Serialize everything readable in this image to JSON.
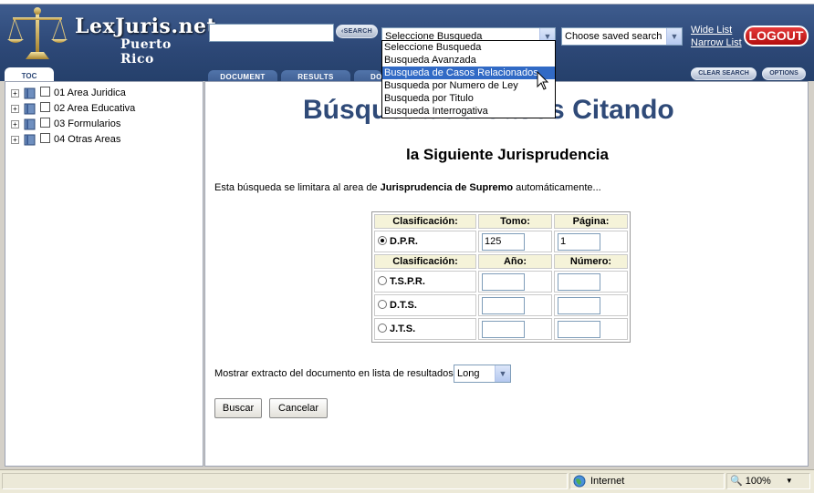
{
  "header": {
    "logo_title": "LexJuris.net",
    "logo_subtitle": "Puerto Rico",
    "search_value": "",
    "search_button": "SEARCH",
    "search_type_selected": "Seleccione Busqueda",
    "saved_search_selected": "Choose saved search",
    "wide_list": "Wide List",
    "narrow_list": "Narrow List",
    "logout": "LOGOUT"
  },
  "search_type_options": [
    "Seleccione Busqueda",
    "Busqueda Avanzada",
    "Busqueda de Casos Relacionados",
    "Busqueda por Numero de Ley",
    "Busqueda por Titulo",
    "Busqueda Interrogativa"
  ],
  "tabs": {
    "toc": "TOC",
    "document": "DOCUMENT",
    "results": "RESULTS",
    "doc_partial": "DO",
    "clear_search": "CLEAR SEARCH",
    "options": "OPTIONS"
  },
  "tree": [
    {
      "label": "01 Area Juridica"
    },
    {
      "label": "02 Area Educativa"
    },
    {
      "label": "03 Formularios"
    },
    {
      "label": "04 Otras Areas"
    }
  ],
  "main": {
    "title": "Búsqueda de Casos Citando",
    "subtitle": "la Siguiente Jurisprudencia",
    "notice_pre": "Esta búsqueda se limitara al area de ",
    "notice_bold": "Jurisprudencia de Supremo",
    "notice_post": " automáticamente...",
    "table1": {
      "headers": [
        "Clasificación:",
        "Tomo:",
        "Página:"
      ],
      "row": {
        "label": "D.P.R.",
        "tomo": "125",
        "pagina": "1",
        "selected": true
      }
    },
    "table2": {
      "headers": [
        "Clasificación:",
        "Año:",
        "Número:"
      ],
      "rows": [
        {
          "label": "T.S.P.R.",
          "ano": "",
          "numero": ""
        },
        {
          "label": "D.T.S.",
          "ano": "",
          "numero": ""
        },
        {
          "label": "J.T.S.",
          "ano": "",
          "numero": ""
        }
      ]
    },
    "extract_label": "Mostrar extracto del documento en lista de resultados",
    "extract_value": "Long",
    "buscar": "Buscar",
    "cancelar": "Cancelar"
  },
  "statusbar": {
    "zone": "Internet",
    "zoom": "100%"
  },
  "colors": {
    "header_bg": "#2d4877",
    "title_blue": "#2f4a78",
    "logout_red": "#c81a1a",
    "selection_blue": "#316ac5",
    "table_header_bg": "#f5f3d9"
  }
}
